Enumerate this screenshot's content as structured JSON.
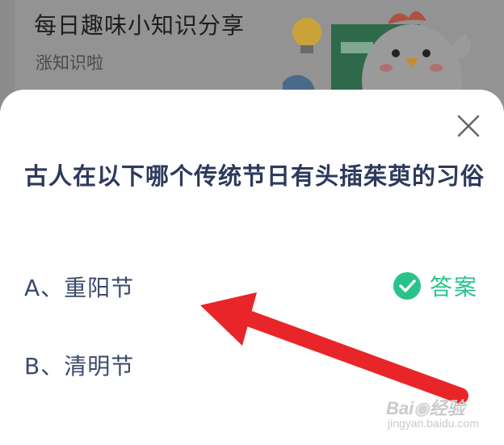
{
  "background": {
    "title": "每日趣味小知识分享",
    "subtitle": "涨知识啦"
  },
  "modal": {
    "question": "古人在以下哪个传统节日有头插茱萸的习俗",
    "options": [
      {
        "label": "A、重阳节",
        "is_answer": true,
        "answer_label": "答案"
      },
      {
        "label": "B、清明节",
        "is_answer": false
      }
    ]
  },
  "annotation": {
    "arrow_color": "#e8262a"
  },
  "colors": {
    "accent_green": "#29c38a",
    "question_text": "#2d3a5c"
  },
  "watermark": {
    "main": "Bai 经验",
    "sub": "jingyan.baidu.com"
  },
  "icons": {
    "close": "close-icon",
    "answer": "check-circle-icon"
  }
}
